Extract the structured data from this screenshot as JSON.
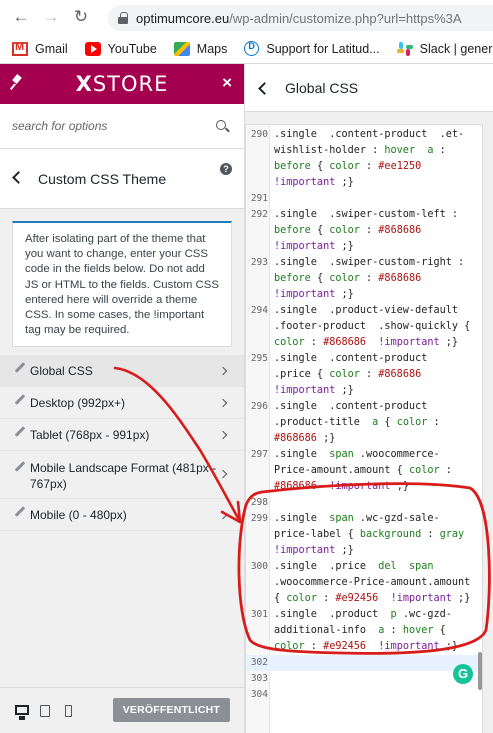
{
  "browser": {
    "url_host": "optimumcore.eu",
    "url_path": "/wp-admin/customize.php?url=https%3A",
    "bookmarks": [
      {
        "label": "Gmail",
        "icon": "gmail-icon"
      },
      {
        "label": "YouTube",
        "icon": "youtube-icon"
      },
      {
        "label": "Maps",
        "icon": "maps-icon"
      },
      {
        "label": "Support for Latitud...",
        "icon": "dell-icon"
      },
      {
        "label": "Slack | general",
        "icon": "slack-icon"
      }
    ]
  },
  "customizer": {
    "brand_prefix": "X",
    "brand_suffix": "STORE",
    "search_placeholder": "search for options",
    "section_title": "Custom CSS Theme",
    "notice": "After isolating part of the theme that you want to change, enter your CSS code in the fields below. Do not add JS or HTML to the fields. Custom CSS entered here will override a theme CSS. In some cases, the !important tag may be required.",
    "items": [
      {
        "label": "Global CSS",
        "active": true
      },
      {
        "label": "Desktop (992px+)",
        "active": false
      },
      {
        "label": "Tablet (768px - 991px)",
        "active": false
      },
      {
        "label": "Mobile Landscape Format (481px - 767px)",
        "active": false
      },
      {
        "label": "Mobile (0 - 480px)",
        "active": false
      }
    ],
    "publish_label": "VERÖFFENTLICHT"
  },
  "editor": {
    "title": "Global CSS",
    "lines": [
      {
        "n": "290",
        "text": ".single  .content-product  .et-"
      },
      {
        "n": "",
        "text": "wishlist-holder : hover  a :"
      },
      {
        "n": "",
        "text": "before { color : #ee1250"
      },
      {
        "n": "",
        "text": "!important ;}"
      },
      {
        "n": "291",
        "text": ""
      },
      {
        "n": "292",
        "text": ".single  .swiper-custom-left :"
      },
      {
        "n": "",
        "text": "before { color : #868686"
      },
      {
        "n": "",
        "text": "!important ;}"
      },
      {
        "n": "293",
        "text": ".single  .swiper-custom-right :"
      },
      {
        "n": "",
        "text": "before { color : #868686"
      },
      {
        "n": "",
        "text": "!important ;}"
      },
      {
        "n": "294",
        "text": ".single  .product-view-default"
      },
      {
        "n": "",
        "text": ".footer-product  .show-quickly {"
      },
      {
        "n": "",
        "text": "color : #868686  !important ;}"
      },
      {
        "n": "295",
        "text": ".single  .content-product"
      },
      {
        "n": "",
        "text": ".price { color : #868686"
      },
      {
        "n": "",
        "text": "!important ;}"
      },
      {
        "n": "296",
        "text": ".single  .content-product"
      },
      {
        "n": "",
        "text": ".product-title  a { color :"
      },
      {
        "n": "",
        "text": "#868686 ;}"
      },
      {
        "n": "297",
        "text": ".single  span .woocommerce-"
      },
      {
        "n": "",
        "text": "Price-amount.amount { color :"
      },
      {
        "n": "",
        "text": "#868686  !important ;}"
      },
      {
        "n": "298",
        "text": ""
      },
      {
        "n": "299",
        "text": ".single  span .wc-gzd-sale-"
      },
      {
        "n": "",
        "text": "price-label { background : gray"
      },
      {
        "n": "",
        "text": "!important ;}"
      },
      {
        "n": "300",
        "text": ".single  .price  del  span"
      },
      {
        "n": "",
        "text": ".woocommerce-Price-amount.amount"
      },
      {
        "n": "",
        "text": "{ color : #e92456  !important ;}"
      },
      {
        "n": "301",
        "text": ".single  .product  p .wc-gzd-"
      },
      {
        "n": "",
        "text": "additional-info  a : hover {"
      },
      {
        "n": "",
        "text": "color : #e92456  !important ;}"
      },
      {
        "n": "302",
        "text": ""
      },
      {
        "n": "303",
        "text": ""
      },
      {
        "n": "304",
        "text": ""
      }
    ]
  },
  "colors": {
    "brand": "#a4004f",
    "annotation": "#d81b1b",
    "grammarly": "#15c39a"
  }
}
